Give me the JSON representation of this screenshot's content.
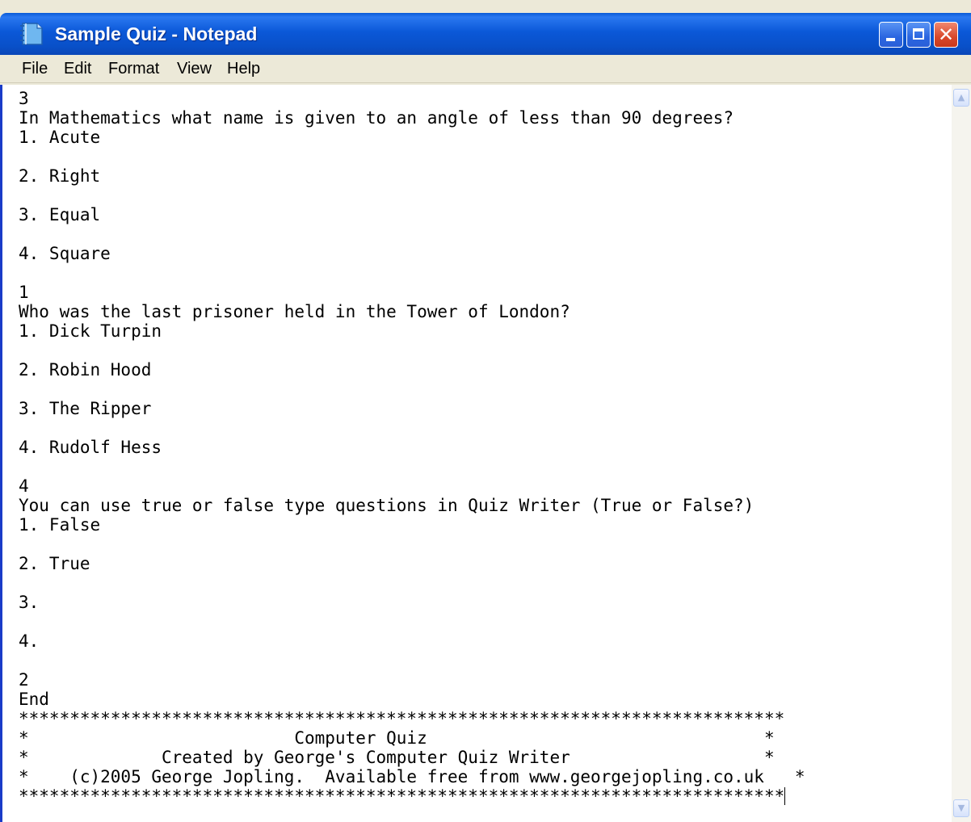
{
  "window": {
    "title": "Sample Quiz - Notepad"
  },
  "menu": [
    "File",
    "Edit",
    "Format",
    "View",
    "Help"
  ],
  "icons": {
    "app": "notepad-icon",
    "minimize": "minimize-icon",
    "maximize": "maximize-icon",
    "close": "close-icon",
    "scroll_up": "scroll-up-arrow-icon",
    "scroll_down": "scroll-down-arrow-icon"
  },
  "colors": {
    "titlebar": "#0a54d2",
    "close_button": "#d9482a"
  },
  "document": {
    "lines": [
      "3",
      "In Mathematics what name is given to an angle of less than 90 degrees?",
      "1. Acute",
      "",
      "2. Right",
      "",
      "3. Equal",
      "",
      "4. Square",
      "",
      "1",
      "Who was the last prisoner held in the Tower of London?",
      "1. Dick Turpin",
      "",
      "2. Robin Hood",
      "",
      "3. The Ripper",
      "",
      "4. Rudolf Hess",
      "",
      "4",
      "You can use true or false type questions in Quiz Writer (True or False?)",
      "1. False",
      "",
      "2. True",
      "",
      "3.",
      "",
      "4.",
      "",
      "2",
      "End",
      "***************************************************************************",
      "*                          Computer Quiz                                 *",
      "*             Created by George's Computer Quiz Writer                   *",
      "*    (c)2005 George Jopling.  Available free from www.georgejopling.co.uk   *",
      "***************************************************************************"
    ]
  }
}
